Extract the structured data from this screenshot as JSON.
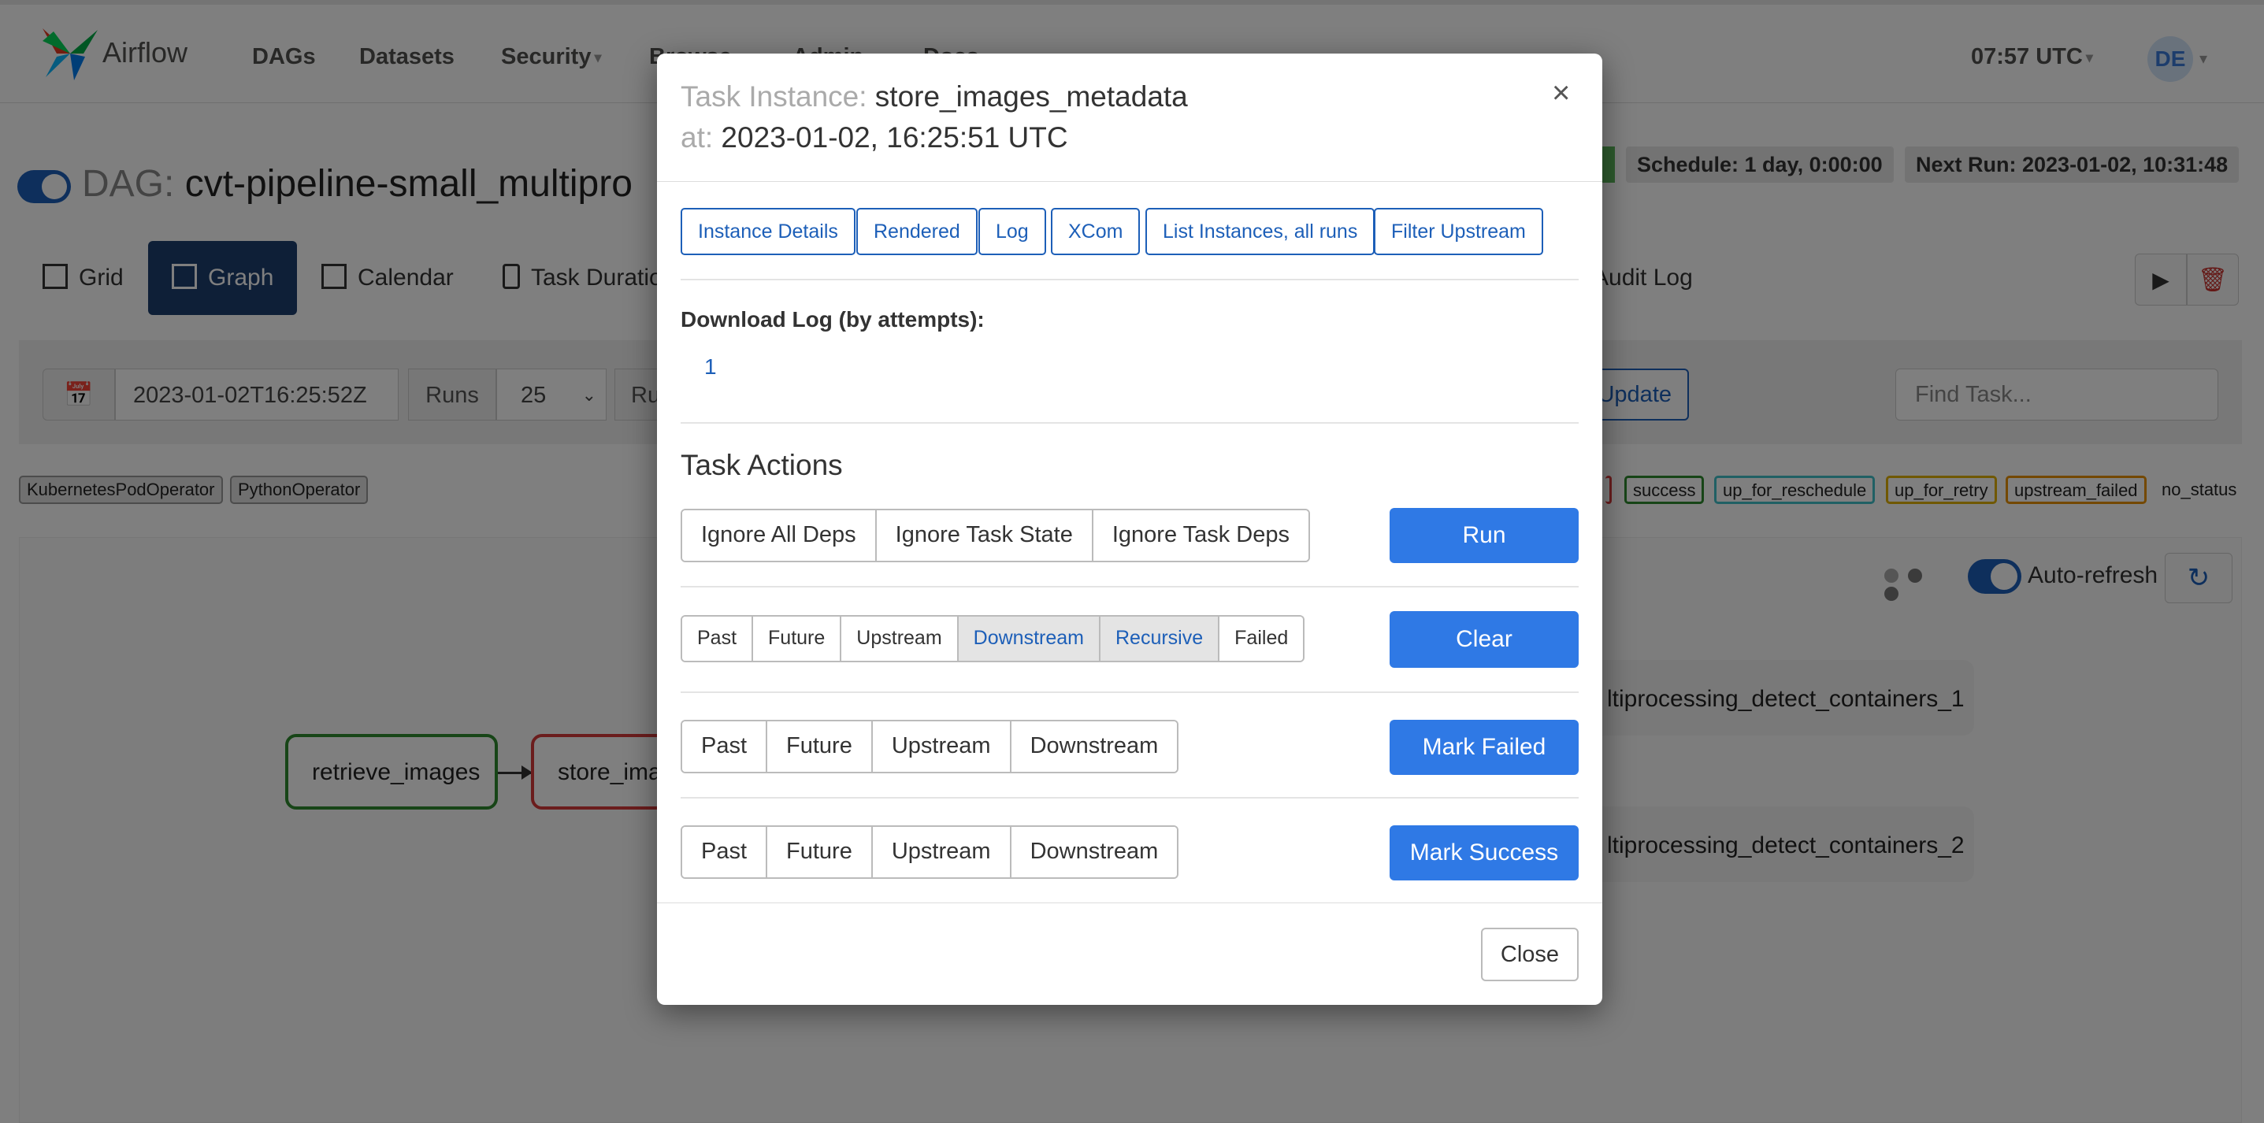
{
  "navbar": {
    "brand": "Airflow",
    "items": [
      "DAGs",
      "Datasets",
      "Security",
      "Browse",
      "Admin",
      "Docs"
    ],
    "clock": "07:57 UTC",
    "avatar": "DE"
  },
  "dag": {
    "label": "DAG:",
    "name": "cvt-pipeline-small_multipro",
    "schedule": "Schedule: 1 day, 0:00:00",
    "next_run": "Next Run: 2023-01-02, 10:31:48"
  },
  "views": {
    "grid": "Grid",
    "graph": "Graph",
    "calendar": "Calendar",
    "task_duration": "Task Duratio",
    "audit_log": "Audit Log"
  },
  "filters": {
    "date": "2023-01-02T16:25:52Z",
    "runs_label": "Runs",
    "runs_value": "25",
    "run_label": "Ru",
    "update": "Update",
    "find_placeholder": "Find Task..."
  },
  "operators": [
    "KubernetesPodOperator",
    "PythonOperator"
  ],
  "states": [
    {
      "label": "success",
      "color": "#2e8b2e"
    },
    {
      "label": "up_for_reschedule",
      "color": "#40c0c8"
    },
    {
      "label": "up_for_retry",
      "color": "#e0b000"
    },
    {
      "label": "upstream_failed",
      "color": "#e89000"
    }
  ],
  "no_status": "no_status",
  "graph": {
    "auto_refresh": "Auto-refresh",
    "nodes": [
      "retrieve_images",
      "store_ima",
      "ltiprocessing_detect_containers_1",
      "ltiprocessing_detect_containers_2"
    ]
  },
  "modal": {
    "ti_label": "Task Instance:",
    "ti_name": "store_images_metadata",
    "at_label": "at:",
    "at_value": "2023-01-02, 16:25:51 UTC",
    "close_x": "×",
    "links": [
      "Instance Details",
      "Rendered",
      "Log",
      "XCom",
      "List Instances, all runs",
      "Filter Upstream"
    ],
    "download_label": "Download Log (by attempts):",
    "download_attempt": "1",
    "actions_title": "Task Actions",
    "run_opts": [
      "Ignore All Deps",
      "Ignore Task State",
      "Ignore Task Deps"
    ],
    "run_btn": "Run",
    "clear_opts": [
      "Past",
      "Future",
      "Upstream",
      "Downstream",
      "Recursive",
      "Failed"
    ],
    "clear_btn": "Clear",
    "failed_opts": [
      "Past",
      "Future",
      "Upstream",
      "Downstream"
    ],
    "failed_btn": "Mark Failed",
    "success_opts": [
      "Past",
      "Future",
      "Upstream",
      "Downstream"
    ],
    "success_btn": "Mark Success",
    "close_btn": "Close"
  }
}
